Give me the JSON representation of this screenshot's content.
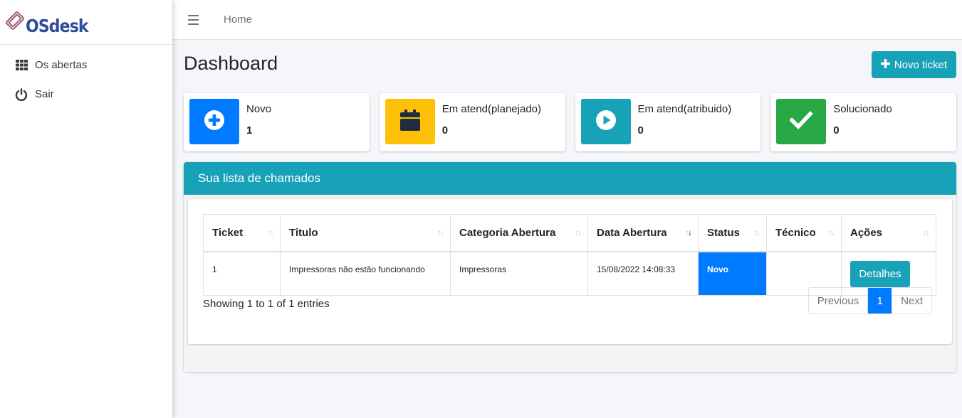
{
  "brand": {
    "name": "OSdesk"
  },
  "sidebar": {
    "items": [
      {
        "label": "Os abertas",
        "icon": "grid-icon"
      },
      {
        "label": "Sair",
        "icon": "power-icon"
      }
    ]
  },
  "topbar": {
    "home_label": "Home"
  },
  "page": {
    "title": "Dashboard",
    "new_ticket_label": "Novo ticket"
  },
  "info_boxes": [
    {
      "label": "Novo",
      "count": "1",
      "color": "#007bff",
      "icon": "plus-circle-icon"
    },
    {
      "label": "Em atend(planejado)",
      "count": "0",
      "color": "#ffc107",
      "icon": "calendar-icon"
    },
    {
      "label": "Em atend(atribuido)",
      "count": "0",
      "color": "#17a2b8",
      "icon": "play-circle-icon"
    },
    {
      "label": "Solucionado",
      "count": "0",
      "color": "#28a745",
      "icon": "check-icon"
    }
  ],
  "ticket_list": {
    "title": "Sua lista de chamados",
    "columns": [
      "Ticket",
      "Titulo",
      "Categoria Abertura",
      "Data Abertura",
      "Status",
      "Técnico",
      "Ações"
    ],
    "rows": [
      {
        "ticket": "1",
        "titulo": "Impressoras não estão funcionando",
        "categoria": "Impressoras",
        "data": "15/08/2022 14:08:33",
        "status": "Novo",
        "tecnico": "",
        "action_label": "Detalhes"
      }
    ],
    "entries_text": "Showing 1 to 1 of 1 entries",
    "pagination": {
      "previous": "Previous",
      "current": "1",
      "next": "Next"
    }
  }
}
